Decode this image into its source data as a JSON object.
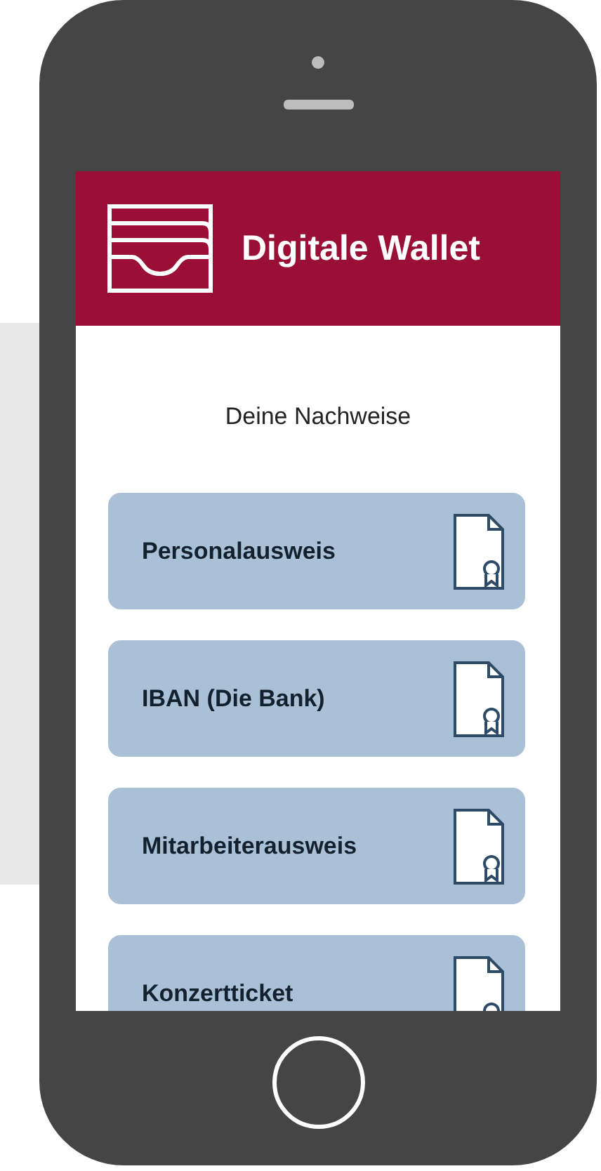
{
  "header": {
    "title": "Digitale Wallet"
  },
  "section_title": "Deine Nachweise",
  "credentials": [
    {
      "label": "Personalausweis"
    },
    {
      "label": "IBAN (Die Bank)"
    },
    {
      "label": "Mitarbeiterausweis"
    },
    {
      "label": "Konzertticket"
    }
  ]
}
